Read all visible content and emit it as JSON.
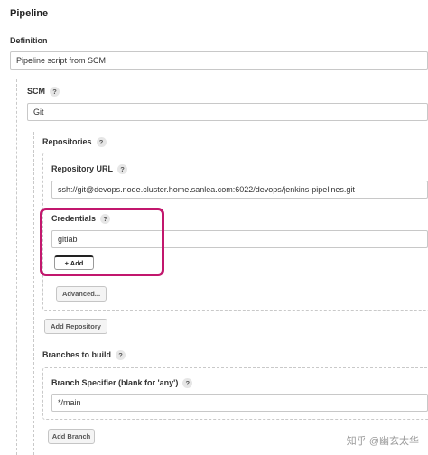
{
  "pipeline": {
    "title": "Pipeline",
    "definition_label": "Definition",
    "definition_value": "Pipeline script from SCM"
  },
  "scm": {
    "label": "SCM",
    "value": "Git"
  },
  "repositories": {
    "label": "Repositories",
    "url_label": "Repository URL",
    "url_value": "ssh://git@devops.node.cluster.home.sanlea.com:6022/devops/jenkins-pipelines.git",
    "credentials_label": "Credentials",
    "credentials_value": "gitlab",
    "add_label": "Add",
    "advanced_label": "Advanced...",
    "add_repository_label": "Add Repository"
  },
  "branches": {
    "label": "Branches to build",
    "specifier_label": "Branch Specifier (blank for 'any')",
    "specifier_value": "*/main",
    "add_branch_label": "Add Branch"
  },
  "help_glyph": "?",
  "plus_glyph": "+",
  "watermark": "知乎 @幽玄太华",
  "colors": {
    "highlight": "#c2176d"
  }
}
